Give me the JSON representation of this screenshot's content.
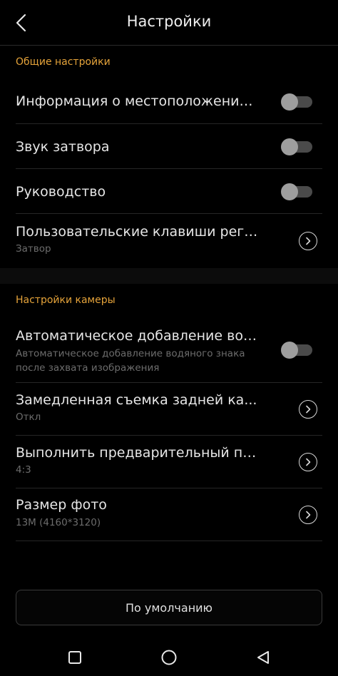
{
  "header": {
    "title": "Настройки",
    "back_icon": "chevron-left-icon"
  },
  "general": {
    "label": "Общие настройки",
    "items": [
      {
        "title": "Информация о местоположении ..",
        "control": "toggle",
        "on": false
      },
      {
        "title": "Звук затвора",
        "control": "toggle",
        "on": false
      },
      {
        "title": "Руководство",
        "control": "toggle",
        "on": false
      },
      {
        "title": "Пользовательские клавиши регу...",
        "subtitle": "Затвор",
        "control": "chevron"
      }
    ]
  },
  "camera": {
    "label": "Настройки камеры",
    "items": [
      {
        "title": "Автоматическое добавление вод..",
        "subtitle": "Автоматическое добавление водяного знака после захвата изображения",
        "control": "toggle",
        "on": false
      },
      {
        "title": "Замедленная съемка задней ка...",
        "subtitle": "Откл",
        "control": "chevron"
      },
      {
        "title": "Выполнить предварительный пр...",
        "subtitle": "4:3",
        "control": "chevron"
      },
      {
        "title": "Размер фото",
        "subtitle": "13M (4160*3120)",
        "control": "chevron"
      }
    ]
  },
  "default_button": {
    "label": "По умолчанию"
  },
  "navbar": {
    "icons": [
      "square-icon",
      "circle-icon",
      "triangle-back-icon"
    ]
  },
  "colors": {
    "accent": "#e5a33a",
    "background": "#000000",
    "text": "#e6e6e6",
    "subtext": "#6c6c6c"
  }
}
